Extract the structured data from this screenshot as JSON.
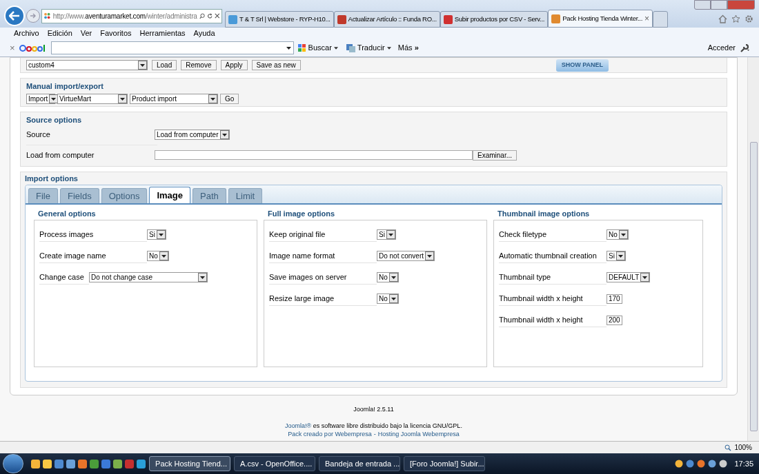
{
  "browser": {
    "url": {
      "scheme": "http://www.",
      "domain": "aventuramarket.com",
      "path": "/winter/administra"
    },
    "tabs": [
      {
        "title": "T & T Srl | Webstore - RYP-H10...",
        "selected": false
      },
      {
        "title": "Actualizar Artículo :: Funda RO...",
        "selected": false
      },
      {
        "title": "Subir productos por CSV - Serv...",
        "selected": false
      },
      {
        "title": "Pack Hosting Tienda Winter...",
        "selected": true
      }
    ],
    "close_tab": "×",
    "menu": [
      "Archivo",
      "Edición",
      "Ver",
      "Favoritos",
      "Herramientas",
      "Ayuda"
    ],
    "toolbar": {
      "close": "×",
      "search": "Buscar",
      "translate": "Traducir",
      "more": "Más",
      "more_arrows": "»",
      "login": "Acceder"
    }
  },
  "template": {
    "value": "custom4",
    "buttons": [
      "Load",
      "Remove",
      "Apply",
      "Save as new"
    ],
    "show_panel": "SHOW PANEL"
  },
  "manual": {
    "title": "Manual import/export",
    "selects": [
      "Import",
      "VirtueMart",
      "Product import"
    ],
    "go": "Go"
  },
  "source": {
    "title": "Source options",
    "source_label": "Source",
    "source_value": "Load from computer",
    "file_label": "Load from computer",
    "browse": "Examinar..."
  },
  "import": {
    "title": "Import options",
    "tabs": [
      {
        "label": "File",
        "selected": false
      },
      {
        "label": "Fields",
        "selected": false
      },
      {
        "label": "Options",
        "selected": false
      },
      {
        "label": "Image",
        "selected": true
      },
      {
        "label": "Path",
        "selected": false
      },
      {
        "label": "Limit",
        "selected": false
      }
    ],
    "columns": [
      {
        "title": "General options",
        "rows": [
          {
            "label": "Process images",
            "kind": "select",
            "value": "Si"
          },
          {
            "label": "Create image name",
            "kind": "select",
            "value": "No"
          },
          {
            "label": "Change case",
            "kind": "wide",
            "value": "Do not change case"
          }
        ]
      },
      {
        "title": "Full image options",
        "rows": [
          {
            "label": "Keep original file",
            "kind": "select",
            "value": "Si"
          },
          {
            "label": "Image name format",
            "kind": "select",
            "value": "Do not convert"
          },
          {
            "label": "Save images on server",
            "kind": "select",
            "value": "No"
          },
          {
            "label": "Resize large image",
            "kind": "select",
            "value": "No"
          }
        ]
      },
      {
        "title": "Thumbnail image options",
        "rows": [
          {
            "label": "Check filetype",
            "kind": "select",
            "value": "No"
          },
          {
            "label": "Automatic thumbnail creation",
            "kind": "select",
            "value": "Si"
          },
          {
            "label": "Thumbnail type",
            "kind": "select",
            "value": "DEFAULT"
          },
          {
            "label": "Thumbnail width x height",
            "kind": "input",
            "value": "170"
          },
          {
            "label": "Thumbnail width x height",
            "kind": "input",
            "value": "200"
          }
        ]
      }
    ]
  },
  "footer": {
    "version": "Joomla! 2.5.11",
    "license_link": "Joomla!®",
    "license_text": "es software libre distribuido bajo la licencia GNU/GPL.",
    "credit_a": "Pack creado por Webempresa",
    "separator": "-",
    "credit_b": "Hosting Joomla Webempresa"
  },
  "status_bar": {
    "zoom": "100%"
  },
  "taskbar": {
    "tasks": [
      {
        "title": "Pack Hosting Tiend...",
        "selected": true
      },
      {
        "title": "A.csv - OpenOffice....",
        "selected": false
      },
      {
        "title": "Bandeja de entrada ...",
        "selected": false
      },
      {
        "title": "[Foro Joomla!] Subir...",
        "selected": false
      }
    ],
    "time": "17:35"
  }
}
